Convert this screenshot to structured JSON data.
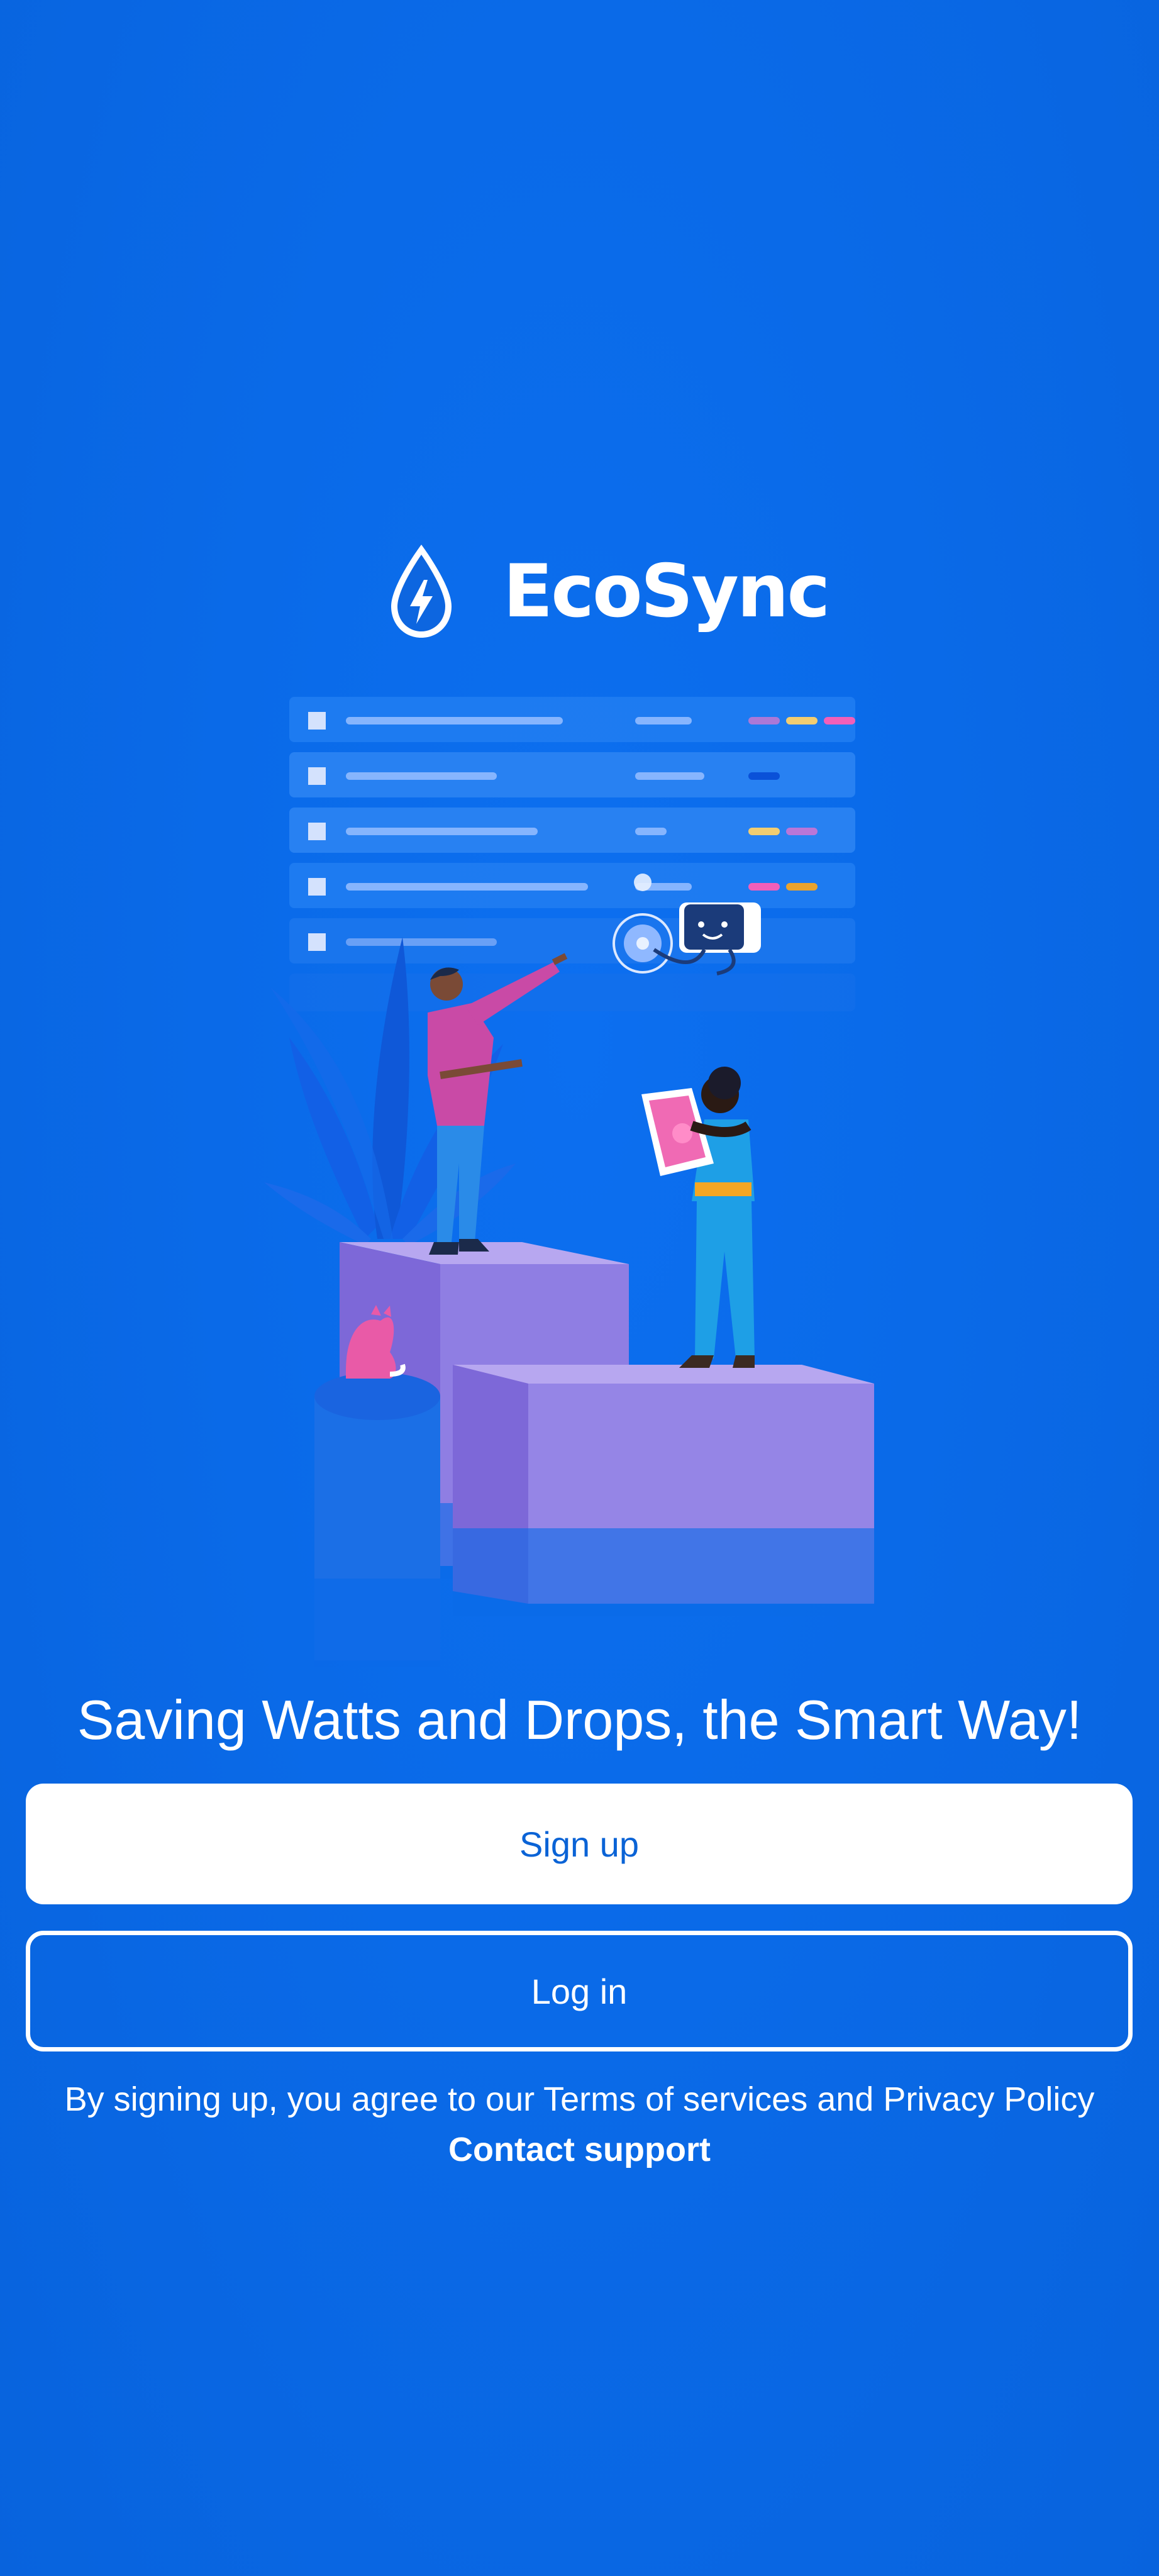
{
  "app": {
    "name": "EcoSync",
    "logo_icon": "water-drop-lightning-icon"
  },
  "hero": {
    "tagline": "Saving Watts and Drops, the Smart Way!",
    "illustration": "people-on-pedestals-with-dashboard-and-robot"
  },
  "actions": {
    "signup_label": "Sign up",
    "login_label": "Log in"
  },
  "legal": {
    "prefix": "By signing up, you agree to our ",
    "terms_label": "Terms of services",
    "and": " and ",
    "privacy_label": "Privacy Policy",
    "support_label": "Contact support"
  },
  "colors": {
    "background": "#0a6ae8",
    "primary_text": "#ffffff",
    "button_text": "#0a63d6"
  }
}
